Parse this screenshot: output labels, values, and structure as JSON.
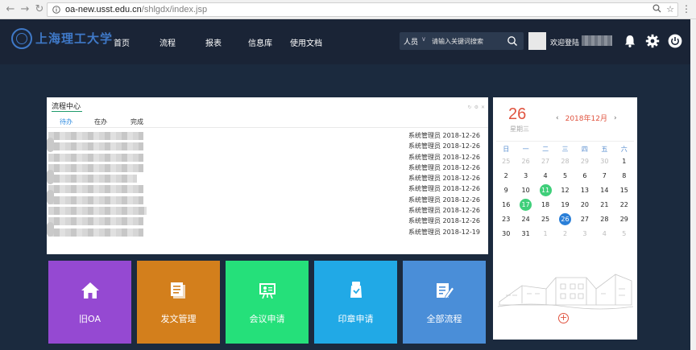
{
  "browser": {
    "url_host": "oa-new.usst.edu.cn",
    "url_path": "/shlgdx/index.jsp"
  },
  "header": {
    "logo_text": "上海理工大学",
    "nav": [
      "首页",
      "流程",
      "报表",
      "信息库",
      "使用文档"
    ],
    "search": {
      "category": "人员",
      "placeholder": "请输入关键词搜索"
    },
    "welcome": "欢迎登陆"
  },
  "process_panel": {
    "title": "流程中心",
    "tabs": [
      "待办",
      "在办",
      "完成"
    ],
    "active_tab": "待办",
    "rows": [
      {
        "owner": "系统管理员",
        "date": "2018-12-26"
      },
      {
        "owner": "系统管理员",
        "date": "2018-12-26"
      },
      {
        "owner": "系统管理员",
        "date": "2018-12-26"
      },
      {
        "owner": "系统管理员",
        "date": "2018-12-26"
      },
      {
        "owner": "系统管理员",
        "date": "2018-12-26"
      },
      {
        "owner": "系统管理员",
        "date": "2018-12-26"
      },
      {
        "owner": "系统管理员",
        "date": "2018-12-26"
      },
      {
        "owner": "系统管理员",
        "date": "2018-12-26"
      },
      {
        "owner": "系统管理员",
        "date": "2018-12-26"
      },
      {
        "owner": "系统管理员",
        "date": "2018-12-19"
      }
    ]
  },
  "calendar": {
    "day": "26",
    "weekday": "星期三",
    "month_label": "2018年12月",
    "week_headers": [
      "日",
      "一",
      "二",
      "三",
      "四",
      "五",
      "六"
    ],
    "days": [
      {
        "d": "25",
        "dim": true
      },
      {
        "d": "26",
        "dim": true
      },
      {
        "d": "27",
        "dim": true
      },
      {
        "d": "28",
        "dim": true
      },
      {
        "d": "29",
        "dim": true
      },
      {
        "d": "30",
        "dim": true
      },
      {
        "d": "1"
      },
      {
        "d": "2"
      },
      {
        "d": "3"
      },
      {
        "d": "4"
      },
      {
        "d": "5"
      },
      {
        "d": "6"
      },
      {
        "d": "7"
      },
      {
        "d": "8"
      },
      {
        "d": "9"
      },
      {
        "d": "10"
      },
      {
        "d": "11",
        "mark": "green"
      },
      {
        "d": "12"
      },
      {
        "d": "13"
      },
      {
        "d": "14"
      },
      {
        "d": "15"
      },
      {
        "d": "16"
      },
      {
        "d": "17",
        "mark": "green"
      },
      {
        "d": "18"
      },
      {
        "d": "19"
      },
      {
        "d": "20"
      },
      {
        "d": "21"
      },
      {
        "d": "22"
      },
      {
        "d": "23"
      },
      {
        "d": "24"
      },
      {
        "d": "25"
      },
      {
        "d": "26",
        "mark": "blue"
      },
      {
        "d": "27"
      },
      {
        "d": "28"
      },
      {
        "d": "29"
      },
      {
        "d": "30"
      },
      {
        "d": "31"
      },
      {
        "d": "1",
        "dim": true
      },
      {
        "d": "2",
        "dim": true
      },
      {
        "d": "3",
        "dim": true
      },
      {
        "d": "4",
        "dim": true
      },
      {
        "d": "5",
        "dim": true
      }
    ]
  },
  "tiles": [
    {
      "label": "旧OA",
      "color": "#9549d2",
      "icon": "home-icon"
    },
    {
      "label": "发文管理",
      "color": "#d37f1c",
      "icon": "document-icon"
    },
    {
      "label": "会议申请",
      "color": "#25e07a",
      "icon": "presentation-icon"
    },
    {
      "label": "印章申请",
      "color": "#21a9e6",
      "icon": "stamp-icon"
    },
    {
      "label": "全部流程",
      "color": "#4a8ed8",
      "icon": "edit-icon"
    }
  ]
}
